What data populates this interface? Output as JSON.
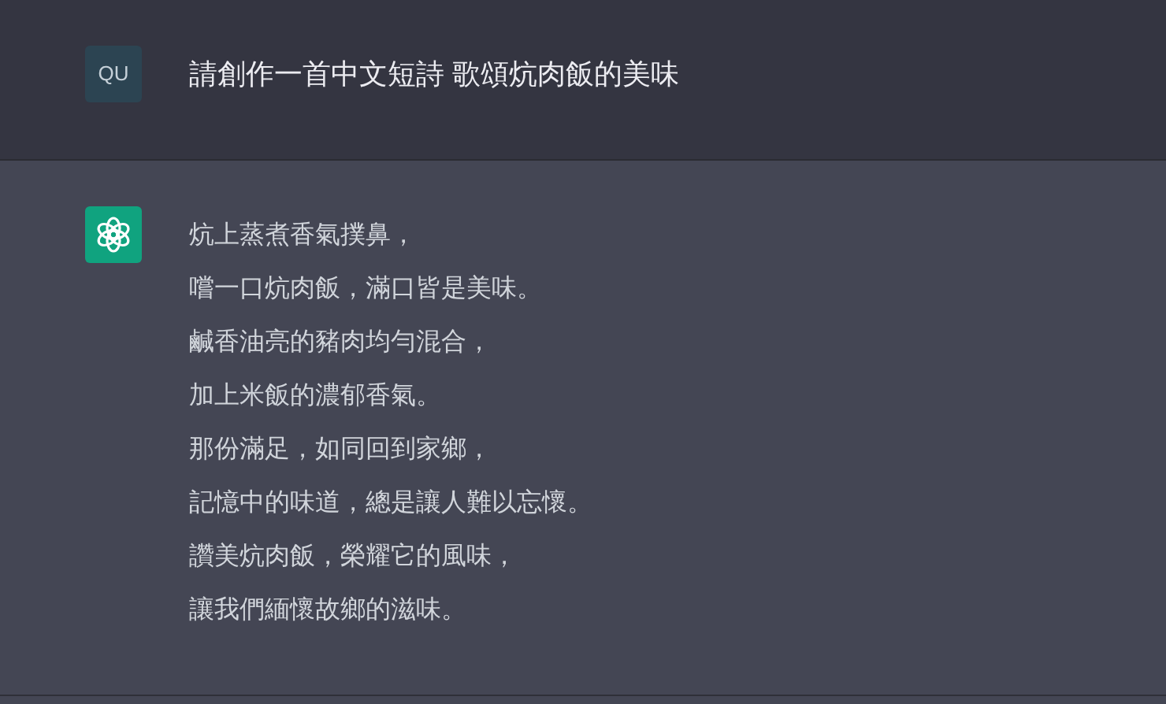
{
  "messages": [
    {
      "kind": "user",
      "avatar": "QU",
      "lines": [
        "請創作一首中文短詩 歌頌炕肉飯的美味"
      ]
    },
    {
      "kind": "assistant",
      "lines": [
        "炕上蒸煮香氣撲鼻，",
        "嚐一口炕肉飯，滿口皆是美味。",
        "鹹香油亮的豬肉均勻混合，",
        "加上米飯的濃郁香氣。",
        "那份滿足，如同回到家鄉，",
        "記憶中的味道，總是讓人難以忘懷。",
        "讚美炕肉飯，榮耀它的風味，",
        "讓我們緬懷故鄉的滋味。"
      ]
    }
  ]
}
